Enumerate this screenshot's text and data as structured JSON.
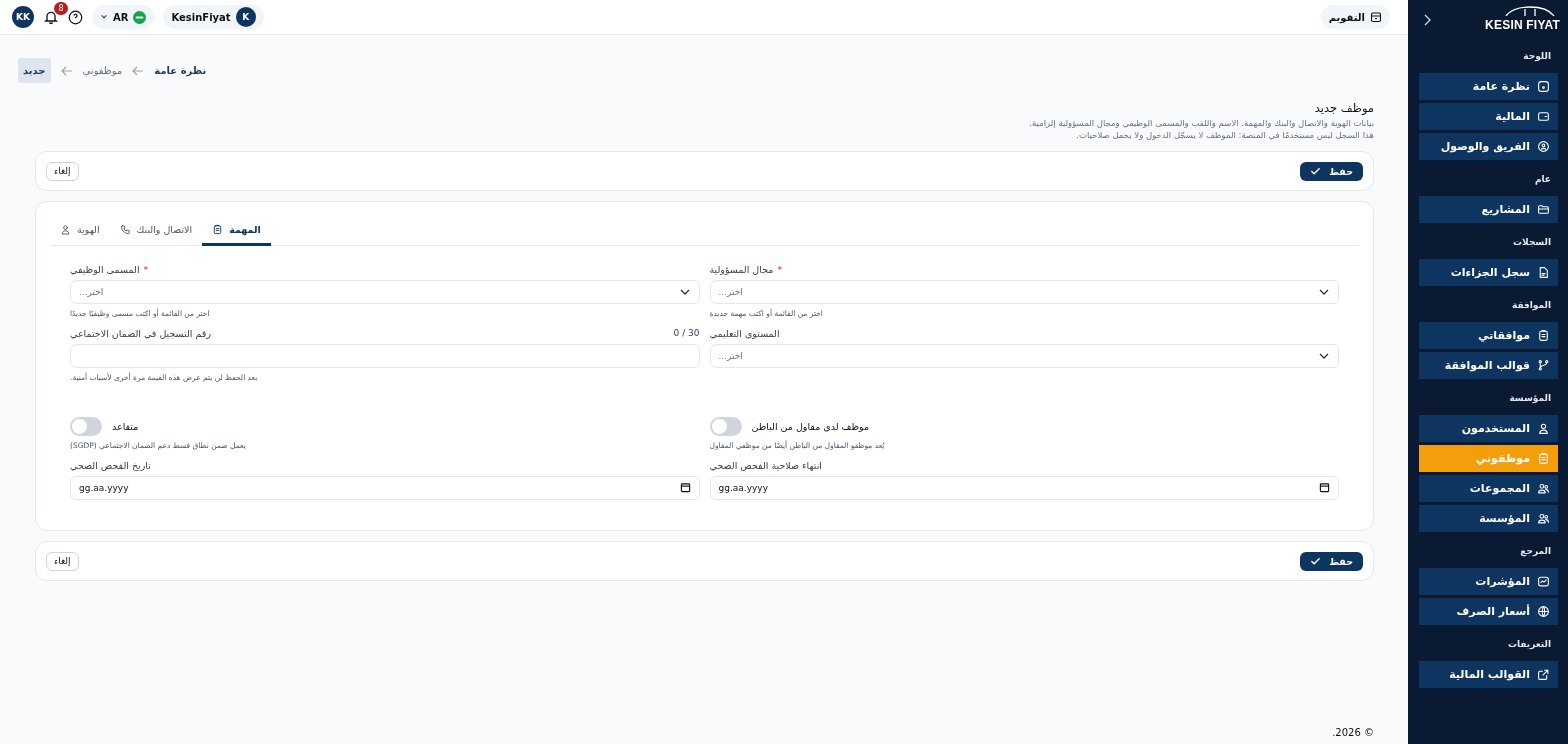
{
  "topbar": {
    "calendar_button": "التقويم",
    "user_avatar": "KK",
    "notifications_count": "8",
    "language": "AR",
    "account_name": "KesinFiyat",
    "account_initial": "K"
  },
  "breadcrumbs": [
    {
      "label": "نظرة عامة",
      "selected": false
    },
    {
      "label": "موظفوني",
      "selected": false
    },
    {
      "label": "جديد",
      "selected": true
    }
  ],
  "page": {
    "title": "موظف جديد",
    "description": [
      "بيانات الهوية والاتصال والبنك والمهمة. الاسم واللقب والمسمى الوظيفي ومجال المسؤولية إلزامية.",
      "هذا السجل ليس مستخدمًا في المنصة: الموظف لا يسجّل الدخول ولا يحمل صلاحيات."
    ]
  },
  "action_bars": [
    {
      "save": "حفظ",
      "cancel": "إلغاء"
    },
    {
      "save": "حفظ",
      "cancel": "إلغاء"
    }
  ],
  "tabs": [
    {
      "label": "المهمة",
      "kind": "clipboard",
      "selected": true
    },
    {
      "label": "الاتصال والبنك",
      "kind": "phone",
      "selected": false
    },
    {
      "label": "الهوية",
      "kind": "user",
      "selected": false
    }
  ],
  "fields": [
    {
      "kind": "select",
      "label": "مجال المسؤولية",
      "required_mark": "*",
      "placeholder": "اختر...",
      "hint": "اختر من القائمة أو اكتب مهمة جديدة"
    },
    {
      "kind": "select",
      "label": "المسمى الوظيفي",
      "required_mark": "*",
      "placeholder": "اختر...",
      "hint": "اختر من القائمة أو اكتب مسمى وظيفيًا جديدًا"
    },
    {
      "kind": "select",
      "label": "المستوى التعليمي",
      "placeholder": "اختر..."
    },
    {
      "kind": "text",
      "label": "رقم التسجيل في الضمان الاجتماعي",
      "counter": "0 / 30",
      "hint": "بعد الحفظ لن يتم عرض هذه القيمة مرة أخرى لأسباب أمنية."
    },
    {
      "kind": "toggle",
      "label": "موظف لدى مقاول من الباطن",
      "on": false,
      "hint": "يُعد موظفو المقاول من الباطن أيضًا من موظفي المقاول"
    },
    {
      "kind": "toggle",
      "label": "متقاعد",
      "on": false,
      "hint": "يعمل ضمن نطاق قسط دعم الضمان الاجتماعي (SGDP)"
    },
    {
      "kind": "date",
      "label": "انتهاء صلاحية الفحص الصحي",
      "placeholder": "gg.aa.yyyy"
    },
    {
      "kind": "date",
      "label": "تاريخ الفحص الصحي",
      "placeholder": "gg.aa.yyyy"
    }
  ],
  "footer": "© 2026.",
  "sidebar": {
    "logo": "KESIN FIYAT",
    "sections": [
      {
        "title": "اللوحة",
        "items": [
          {
            "label": "نظرة عامة",
            "kind": "home",
            "selected": false
          },
          {
            "label": "المالية",
            "kind": "wallet",
            "selected": false
          },
          {
            "label": "الفريق والوصول",
            "kind": "shield",
            "selected": false
          }
        ]
      },
      {
        "title": "عام",
        "items": [
          {
            "label": "المشاريع",
            "kind": "folder",
            "selected": false
          }
        ]
      },
      {
        "title": "السجلات",
        "items": [
          {
            "label": "سجل الجزاءات",
            "kind": "file",
            "selected": false
          }
        ]
      },
      {
        "title": "الموافقة",
        "items": [
          {
            "label": "موافقاتي",
            "kind": "clipboard",
            "selected": false
          },
          {
            "label": "قوالب الموافقة",
            "kind": "branch",
            "selected": false
          }
        ]
      },
      {
        "title": "المؤسسة",
        "items": [
          {
            "label": "المستخدمون",
            "kind": "user",
            "selected": false
          },
          {
            "label": "موظفوني",
            "kind": "clipboard",
            "selected": true
          },
          {
            "label": "المجموعات",
            "kind": "users",
            "selected": false
          },
          {
            "label": "المؤسسة",
            "kind": "users",
            "selected": false
          }
        ]
      },
      {
        "title": "المرجع",
        "items": [
          {
            "label": "المؤشرات",
            "kind": "chart",
            "selected": false
          },
          {
            "label": "أسعار الصرف",
            "kind": "globe",
            "selected": false
          }
        ]
      },
      {
        "title": "التعريفات",
        "items": [
          {
            "label": "القوالب المالية",
            "kind": "external",
            "selected": false
          }
        ]
      }
    ]
  }
}
